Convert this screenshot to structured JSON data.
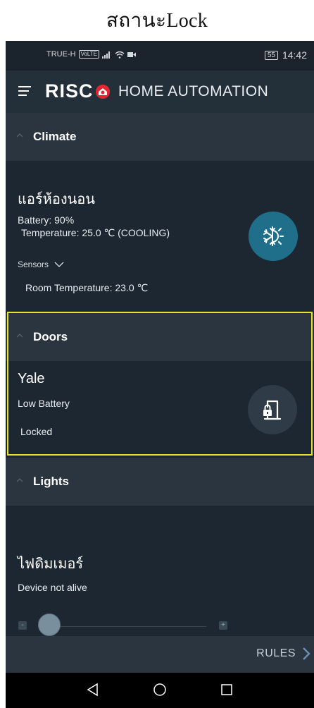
{
  "caption": "สถานะLock",
  "status_bar": {
    "carrier": "TRUE-H",
    "volte": "VoLTE",
    "battery": "55",
    "time": "14:42"
  },
  "app_bar": {
    "logo": "RISC",
    "title": "HOME AUTOMATION"
  },
  "sections": {
    "climate": {
      "title": "Climate",
      "device_name": "แอร์ห้องนอน",
      "battery": "Battery: 90%",
      "temperature": "Temperature: 25.0 ℃ (COOLING)",
      "sensors_label": "Sensors",
      "room_temperature": "Room Temperature: 23.0 ℃",
      "icon": "snowflake-sun-icon"
    },
    "doors": {
      "title": "Doors",
      "device_name": "Yale",
      "battery": "Low Battery",
      "state": "Locked",
      "icon": "door-lock-icon"
    },
    "lights": {
      "title": "Lights",
      "device_name": "ไฟดิมเมอร์",
      "status": "Device not alive",
      "slider_minus": "-",
      "slider_plus": "+"
    }
  },
  "bottom_bar": {
    "rules_label": "RULES"
  },
  "colors": {
    "accent_blue": "#1f6f8b",
    "logo_red": "#e3262f",
    "highlight": "#e7e130",
    "background": "#1d2731",
    "header": "#2a353f"
  }
}
